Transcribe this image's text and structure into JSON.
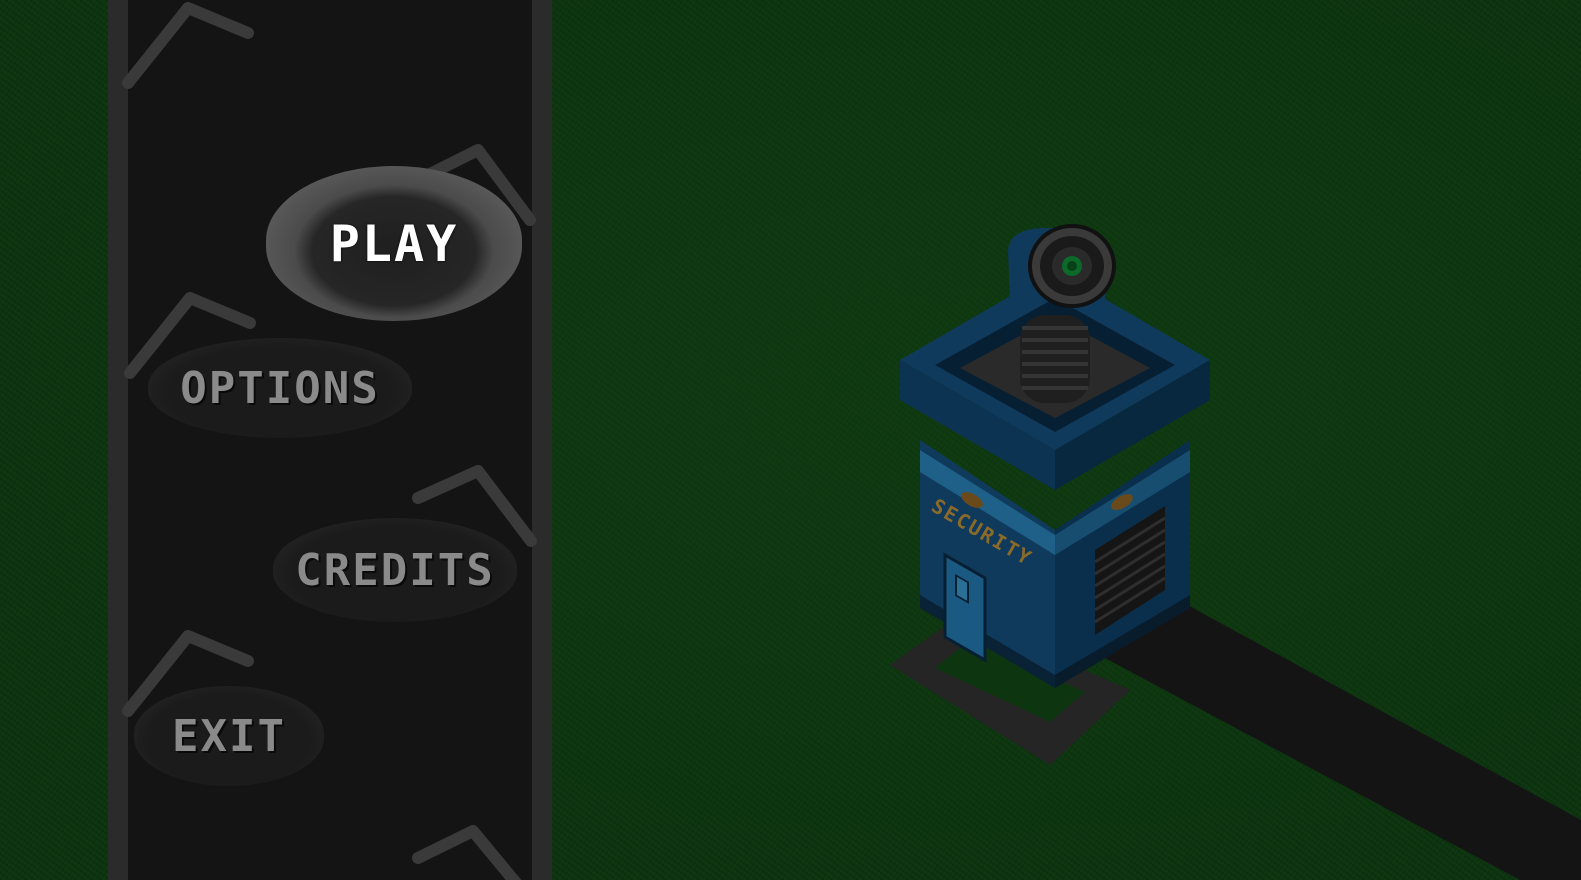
{
  "menu": {
    "items": [
      {
        "label": "PLAY",
        "state": "highlighted"
      },
      {
        "label": "OPTIONS",
        "state": "idle"
      },
      {
        "label": "CREDITS",
        "state": "idle"
      },
      {
        "label": "EXIT",
        "state": "idle"
      }
    ]
  },
  "building": {
    "sign": "SECURITY"
  },
  "colors": {
    "grass": "#0d3510",
    "panel": "#141414",
    "panel_border": "#2b2b2b",
    "building_blue": "#0f3a5c",
    "button_active_text": "#ffffff",
    "button_idle_text": "#8a8a8a",
    "lamp_light": "#f0c060"
  },
  "icons": [
    "street-lamp-icon",
    "security-camera-icon"
  ]
}
